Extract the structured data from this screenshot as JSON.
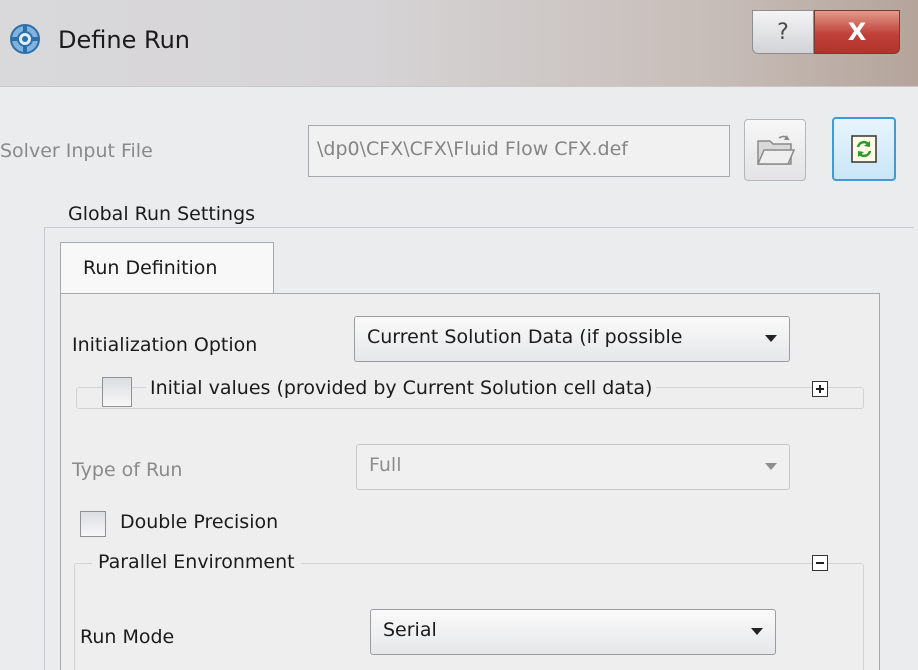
{
  "window": {
    "title": "Define Run",
    "title_icon": "gear-icon",
    "help_label": "?",
    "close_label": "X"
  },
  "solver_input": {
    "label": "Solver Input File",
    "value": "\\dp0\\CFX\\CFX\\Fluid Flow CFX.def",
    "browse_icon": "folder-open-icon",
    "reload_icon": "reload-icon"
  },
  "global_run_settings": {
    "label": "Global Run Settings",
    "tabs": [
      {
        "label": "Run Definition",
        "active": true
      }
    ],
    "initialization_option": {
      "label": "Initialization Option",
      "value": "Current Solution Data (if possible"
    },
    "initial_values": {
      "label": "Initial values (provided by Current Solution cell data)",
      "checked": false,
      "expanded": false
    },
    "type_of_run": {
      "label": "Type of Run",
      "value": "Full",
      "enabled": false
    },
    "double_precision": {
      "label": "Double Precision",
      "checked": false
    },
    "parallel_environment": {
      "label": "Parallel Environment",
      "expanded": true,
      "run_mode": {
        "label": "Run Mode",
        "value": "Serial"
      }
    }
  },
  "colors": {
    "accent": "#3f9bd4",
    "close_button": "#c0413a",
    "disabled_text": "#8a8a8a"
  }
}
